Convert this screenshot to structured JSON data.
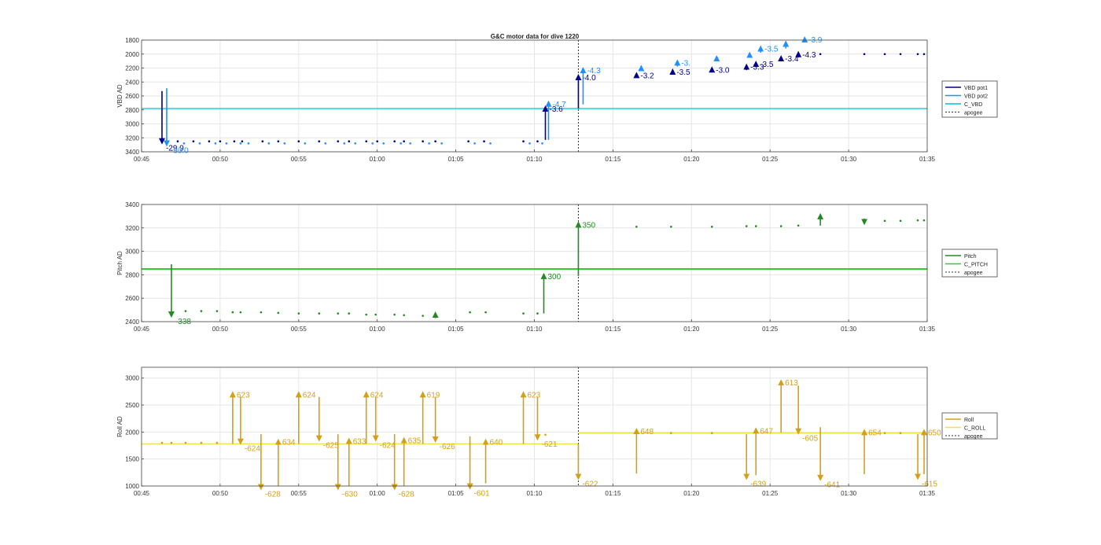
{
  "figure": {
    "title": "G&C motor data for dive 1220"
  },
  "colors": {
    "vbd_pot1": "#00008b",
    "vbd_pot2": "#1e90ff",
    "c_vbd": "#00bfd8",
    "pitch": "#228b22",
    "c_pitch": "#32cd32",
    "roll": "#d4a017",
    "c_roll": "#f4e04d",
    "apogee": "#333333"
  },
  "chart_data": [
    {
      "type": "line",
      "ylabel": "VBD AD",
      "ylim": [
        1800,
        3400
      ],
      "y_reversed": true,
      "xlim": [
        "00:45",
        "01:35"
      ],
      "yticks": [
        "1800",
        "2000",
        "2200",
        "2400",
        "2600",
        "2800",
        "3000",
        "3200",
        "3400"
      ],
      "xticks": [
        "00:45",
        "00:50",
        "00:55",
        "01:00",
        "01:05",
        "01:10",
        "01:15",
        "01:20",
        "01:25",
        "01:30",
        "01:35"
      ],
      "grid": true,
      "legend_position": "right",
      "legend": [
        "VBD pot1",
        "VBD pot2",
        "C_VBD",
        "apogee"
      ],
      "apogee": "01:12.8",
      "c_vbd": 2780,
      "arrows": [
        {
          "series": "VBD pot1",
          "t": "00:46.3",
          "from": 2530,
          "to": 3250,
          "label": "-29.9"
        },
        {
          "series": "VBD pot2",
          "t": "00:46.6",
          "from": 2490,
          "to": 3280,
          "label": "-33.0"
        },
        {
          "series": "VBD pot1",
          "t": "01:10.7",
          "from": 3230,
          "to": 2780,
          "label": "-3.6"
        },
        {
          "series": "VBD pot2",
          "t": "01:10.9",
          "from": 3230,
          "to": 2710,
          "label": "-4.7"
        },
        {
          "series": "VBD pot1",
          "t": "01:12.8",
          "from": 2780,
          "to": 2330,
          "label": "-4.0"
        },
        {
          "series": "VBD pot2",
          "t": "01:13.1",
          "from": 2720,
          "to": 2230,
          "label": "-4.3"
        },
        {
          "series": "VBD pot1",
          "t": "01:16.5",
          "from": 2320,
          "to": 2300,
          "label": "-3.2"
        },
        {
          "series": "VBD pot2",
          "t": "01:16.8",
          "from": 2230,
          "to": 2200,
          "label": ""
        },
        {
          "series": "VBD pot1",
          "t": "01:18.8",
          "from": 2290,
          "to": 2250,
          "label": "-3.5"
        },
        {
          "series": "VBD pot2",
          "t": "01:19.1",
          "from": 2180,
          "to": 2120,
          "label": "-3."
        },
        {
          "series": "VBD pot1",
          "t": "01:21.3",
          "from": 2250,
          "to": 2220,
          "label": "-3.0"
        },
        {
          "series": "VBD pot2",
          "t": "01:21.6",
          "from": 2090,
          "to": 2060,
          "label": ""
        },
        {
          "series": "VBD pot1",
          "t": "01:23.5",
          "from": 2230,
          "to": 2180,
          "label": "-3.3"
        },
        {
          "series": "VBD pot2",
          "t": "01:23.7",
          "from": 2050,
          "to": 2010,
          "label": ""
        },
        {
          "series": "VBD pot1",
          "t": "01:24.1",
          "from": 2170,
          "to": 2140,
          "label": "-3.5"
        },
        {
          "series": "VBD pot2",
          "t": "01:24.4",
          "from": 1980,
          "to": 1920,
          "label": "-3.5"
        },
        {
          "series": "VBD pot1",
          "t": "01:25.7",
          "from": 2100,
          "to": 2060,
          "label": "-3.4"
        },
        {
          "series": "VBD pot2",
          "t": "01:26.0",
          "from": 1920,
          "to": 1850,
          "label": ""
        },
        {
          "series": "VBD pot1",
          "t": "01:26.8",
          "from": 2050,
          "to": 2000,
          "label": "-4.3"
        },
        {
          "series": "VBD pot2",
          "t": "01:27.2",
          "from": 1830,
          "to": 1790,
          "label": "-3.9"
        }
      ],
      "dots_pot1": [
        [
          "00:47.3",
          3250
        ],
        [
          "00:48.3",
          3250
        ],
        [
          "00:49.3",
          3250
        ],
        [
          "00:50.0",
          3250
        ],
        [
          "00:50.9",
          3250
        ],
        [
          "00:51.4",
          3250
        ],
        [
          "00:52.7",
          3250
        ],
        [
          "00:53.7",
          3250
        ],
        [
          "00:55.0",
          3250
        ],
        [
          "00:56.3",
          3250
        ],
        [
          "00:57.5",
          3250
        ],
        [
          "00:58.2",
          3250
        ],
        [
          "00:59.3",
          3250
        ],
        [
          "01:00.0",
          3250
        ],
        [
          "01:01.1",
          3250
        ],
        [
          "01:01.7",
          3250
        ],
        [
          "01:02.9",
          3250
        ],
        [
          "01:03.7",
          3250
        ],
        [
          "01:05.8",
          3250
        ],
        [
          "01:06.8",
          3250
        ],
        [
          "01:09.3",
          3250
        ],
        [
          "01:10.2",
          3250
        ],
        [
          "01:28.2",
          2000
        ],
        [
          "01:31.0",
          2000
        ],
        [
          "01:32.3",
          2000
        ],
        [
          "01:33.3",
          2000
        ],
        [
          "01:34.4",
          2000
        ],
        [
          "01:34.8",
          2000
        ]
      ],
      "dots_pot2": [
        [
          "00:47.7",
          3280
        ],
        [
          "00:48.7",
          3280
        ],
        [
          "00:49.7",
          3280
        ],
        [
          "00:50.4",
          3280
        ],
        [
          "00:51.3",
          3280
        ],
        [
          "00:51.8",
          3280
        ],
        [
          "00:53.1",
          3280
        ],
        [
          "00:54.1",
          3280
        ],
        [
          "00:55.4",
          3280
        ],
        [
          "00:56.7",
          3280
        ],
        [
          "00:57.9",
          3280
        ],
        [
          "00:58.6",
          3280
        ],
        [
          "00:59.7",
          3280
        ],
        [
          "01:00.4",
          3280
        ],
        [
          "01:01.5",
          3280
        ],
        [
          "01:02.1",
          3280
        ],
        [
          "01:03.3",
          3280
        ],
        [
          "01:04.1",
          3280
        ],
        [
          "01:06.2",
          3280
        ],
        [
          "01:07.2",
          3280
        ],
        [
          "01:09.7",
          3280
        ],
        [
          "01:10.5",
          3280
        ]
      ]
    },
    {
      "type": "line",
      "ylabel": "Pitch AD",
      "ylim": [
        2400,
        3400
      ],
      "xlim": [
        "00:45",
        "01:35"
      ],
      "yticks": [
        "2400",
        "2600",
        "2800",
        "3000",
        "3200",
        "3400"
      ],
      "xticks": [
        "00:45",
        "00:50",
        "00:55",
        "01:00",
        "01:05",
        "01:10",
        "01:15",
        "01:20",
        "01:25",
        "01:30",
        "01:35"
      ],
      "grid": true,
      "legend_position": "right",
      "legend": [
        "Pitch",
        "C_PITCH",
        "apogee"
      ],
      "apogee": "01:12.8",
      "c_pitch": 2850,
      "arrows": [
        {
          "t": "00:46.9",
          "from": 2890,
          "to": 2460,
          "label": "-338"
        },
        {
          "t": "01:03.7",
          "from": 2430,
          "to": 2460,
          "label": ""
        },
        {
          "t": "01:10.6",
          "from": 2470,
          "to": 2790,
          "label": "300"
        },
        {
          "t": "01:12.8",
          "from": 2790,
          "to": 3230,
          "label": "350"
        },
        {
          "t": "01:28.2",
          "from": 3220,
          "to": 3300,
          "label": ""
        },
        {
          "t": "01:31.0",
          "from": 3280,
          "to": 3250,
          "label": ""
        }
      ],
      "dots": [
        [
          "00:47.8",
          2490
        ],
        [
          "00:48.8",
          2490
        ],
        [
          "00:49.8",
          2490
        ],
        [
          "00:50.8",
          2480
        ],
        [
          "00:51.3",
          2480
        ],
        [
          "00:52.6",
          2480
        ],
        [
          "00:53.7",
          2475
        ],
        [
          "00:55.0",
          2470
        ],
        [
          "00:56.3",
          2470
        ],
        [
          "00:57.5",
          2470
        ],
        [
          "00:58.2",
          2470
        ],
        [
          "00:59.3",
          2460
        ],
        [
          "00:59.9",
          2460
        ],
        [
          "01:01.1",
          2460
        ],
        [
          "01:01.7",
          2455
        ],
        [
          "01:02.9",
          2450
        ],
        [
          "01:05.9",
          2480
        ],
        [
          "01:06.9",
          2480
        ],
        [
          "01:09.3",
          2470
        ],
        [
          "01:10.2",
          2470
        ],
        [
          "01:16.5",
          3210
        ],
        [
          "01:18.7",
          3210
        ],
        [
          "01:21.3",
          3210
        ],
        [
          "01:23.5",
          3215
        ],
        [
          "01:24.1",
          3215
        ],
        [
          "01:25.7",
          3215
        ],
        [
          "01:26.8",
          3220
        ],
        [
          "01:32.3",
          3260
        ],
        [
          "01:33.3",
          3260
        ],
        [
          "01:34.4",
          3265
        ],
        [
          "01:34.8",
          3265
        ]
      ]
    },
    {
      "type": "line",
      "ylabel": "Roll AD",
      "ylim": [
        1000,
        3200
      ],
      "xlim": [
        "00:45",
        "01:35"
      ],
      "yticks": [
        "1000",
        "1500",
        "2000",
        "2500",
        "3000"
      ],
      "xticks": [
        "00:45",
        "00:50",
        "00:55",
        "01:00",
        "01:05",
        "01:10",
        "01:15",
        "01:20",
        "01:25",
        "01:30",
        "01:35"
      ],
      "grid": true,
      "legend_position": "right",
      "legend": [
        "Roll",
        "C_ROLL",
        "apogee"
      ],
      "apogee": "01:12.8",
      "c_roll_before": 1780,
      "c_roll_after": 1980,
      "arrows": [
        {
          "t": "00:50.8",
          "from": 1780,
          "to": 2700,
          "label": "623"
        },
        {
          "t": "00:51.3",
          "from": 2650,
          "to": 1820,
          "label": "-624"
        },
        {
          "t": "00:52.6",
          "from": 1960,
          "to": 980,
          "label": "-628"
        },
        {
          "t": "00:53.7",
          "from": 1000,
          "to": 1820,
          "label": "634"
        },
        {
          "t": "00:55.0",
          "from": 1780,
          "to": 2700,
          "label": "624"
        },
        {
          "t": "00:56.3",
          "from": 2650,
          "to": 1880,
          "label": "-625"
        },
        {
          "t": "00:57.5",
          "from": 1960,
          "to": 980,
          "label": "-630"
        },
        {
          "t": "00:58.2",
          "from": 1000,
          "to": 1840,
          "label": "633"
        },
        {
          "t": "00:59.3",
          "from": 1780,
          "to": 2700,
          "label": "624"
        },
        {
          "t": "00:59.9",
          "from": 2650,
          "to": 1880,
          "label": "-624"
        },
        {
          "t": "01:01.1",
          "from": 1960,
          "to": 980,
          "label": "-628"
        },
        {
          "t": "01:01.7",
          "from": 1000,
          "to": 1850,
          "label": "635"
        },
        {
          "t": "01:02.9",
          "from": 1780,
          "to": 2700,
          "label": "619"
        },
        {
          "t": "01:03.7",
          "from": 2650,
          "to": 1860,
          "label": "-626"
        },
        {
          "t": "01:05.9",
          "from": 1920,
          "to": 990,
          "label": "-601"
        },
        {
          "t": "01:06.9",
          "from": 1050,
          "to": 1820,
          "label": "640"
        },
        {
          "t": "01:09.3",
          "from": 1780,
          "to": 2700,
          "label": "623"
        },
        {
          "t": "01:10.2",
          "from": 2650,
          "to": 1900,
          "label": "-621"
        },
        {
          "t": "01:12.8",
          "from": 1780,
          "to": 1170,
          "label": "-622"
        },
        {
          "t": "01:16.5",
          "from": 1230,
          "to": 2020,
          "label": "648"
        },
        {
          "t": "01:23.5",
          "from": 1960,
          "to": 1170,
          "label": "-639"
        },
        {
          "t": "01:24.1",
          "from": 1200,
          "to": 2030,
          "label": "647"
        },
        {
          "t": "01:25.7",
          "from": 1990,
          "to": 2920,
          "label": "613"
        },
        {
          "t": "01:26.8",
          "from": 2860,
          "to": 2010,
          "label": "-605"
        },
        {
          "t": "01:28.2",
          "from": 2090,
          "to": 1150,
          "label": "-641"
        },
        {
          "t": "01:31.0",
          "from": 1220,
          "to": 2000,
          "label": "654"
        },
        {
          "t": "01:34.4",
          "from": 1960,
          "to": 1170,
          "label": "-615"
        },
        {
          "t": "01:34.8",
          "from": 1220,
          "to": 2000,
          "label": "650"
        }
      ],
      "dots": [
        [
          "00:46.3",
          1800
        ],
        [
          "00:46.9",
          1800
        ],
        [
          "00:47.8",
          1800
        ],
        [
          "00:48.8",
          1800
        ],
        [
          "00:49.8",
          1800
        ],
        [
          "01:10.7",
          1950
        ],
        [
          "01:18.7",
          1980
        ],
        [
          "01:21.3",
          1980
        ],
        [
          "01:32.3",
          1980
        ],
        [
          "01:33.3",
          1980
        ]
      ]
    }
  ]
}
